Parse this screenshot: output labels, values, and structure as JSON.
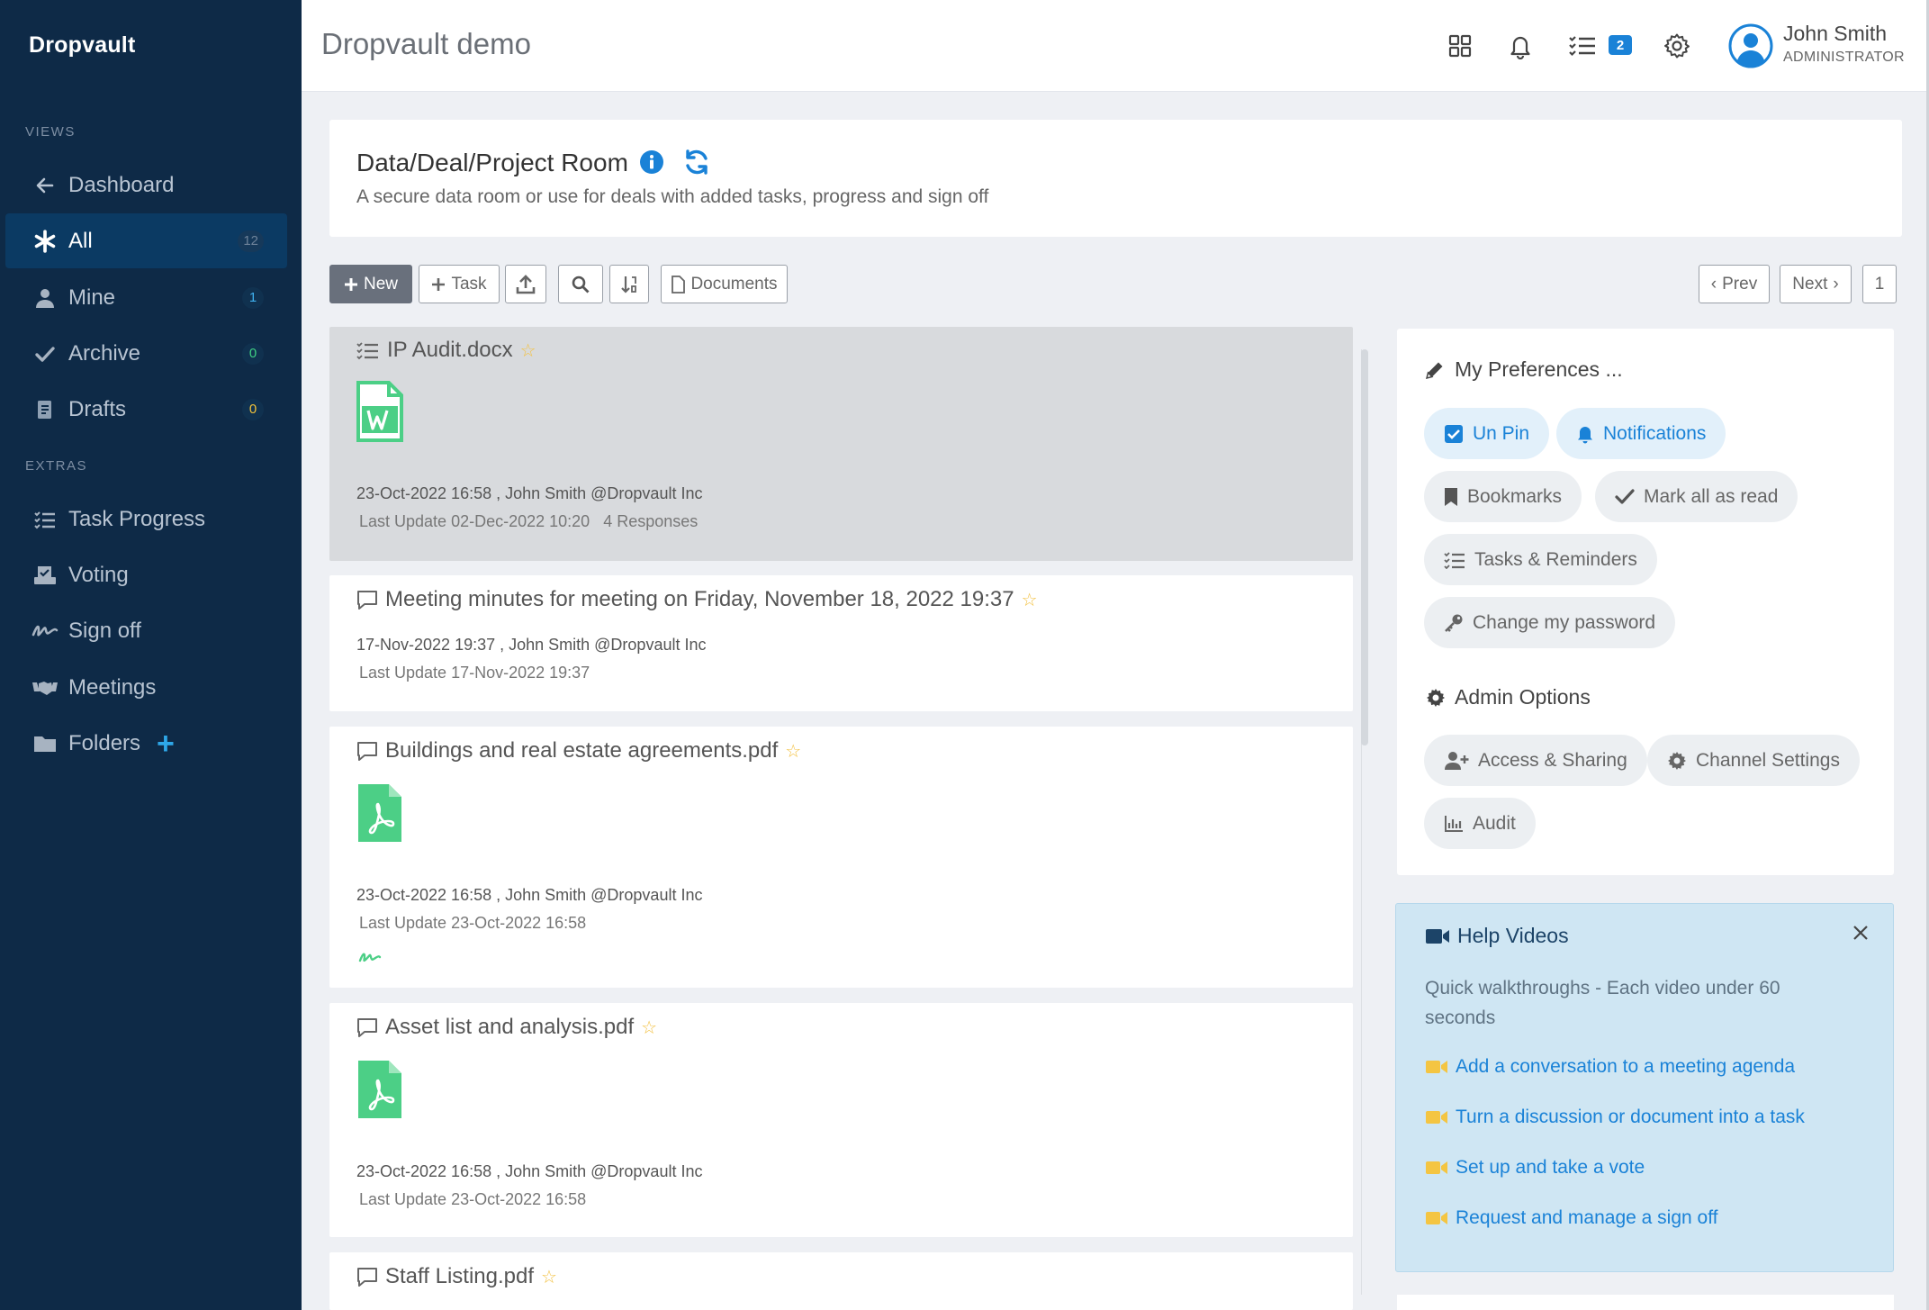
{
  "sidebar": {
    "brand": "Dropvault",
    "views_label": "VIEWS",
    "extras_label": "EXTRAS",
    "views": [
      {
        "label": "Dashboard",
        "icon": "arrow-left-icon",
        "count": null
      },
      {
        "label": "All",
        "icon": "asterisk-icon",
        "count": "12"
      },
      {
        "label": "Mine",
        "icon": "user-icon",
        "count": "1"
      },
      {
        "label": "Archive",
        "icon": "check-icon",
        "count": "0"
      },
      {
        "label": "Drafts",
        "icon": "draft-icon",
        "count": "0"
      }
    ],
    "extras": [
      {
        "label": "Task Progress",
        "icon": "task-list-icon"
      },
      {
        "label": "Voting",
        "icon": "ballot-icon"
      },
      {
        "label": "Sign off",
        "icon": "signature-icon"
      },
      {
        "label": "Meetings",
        "icon": "handshake-icon"
      },
      {
        "label": "Folders",
        "icon": "folder-icon",
        "action": "+"
      }
    ]
  },
  "header": {
    "title": "Dropvault demo",
    "task_badge": "2",
    "user_name": "John Smith",
    "user_role": "ADMINISTRATOR",
    "icons": [
      "grid-icon",
      "bell-icon",
      "task-list-icon",
      "gear-icon",
      "avatar-icon"
    ]
  },
  "room": {
    "title": "Data/Deal/Project Room",
    "subtitle": "A secure data room or use for deals with added tasks, progress and sign off"
  },
  "toolbar": {
    "new_label": "New",
    "task_label": "Task",
    "documents_label": "Documents",
    "prev_label": "Prev",
    "next_label": "Next",
    "page": "1"
  },
  "documents": [
    {
      "title": "IP Audit.docx",
      "type": "word",
      "meta": "23-Oct-2022 16:58 , John Smith @Dropvault Inc",
      "updated": "Last Update 02-Dec-2022 10:20",
      "responses": "4 Responses"
    },
    {
      "title": "Meeting minutes for meeting on Friday, November 18, 2022 19:37",
      "type": "conversation",
      "meta": "17-Nov-2022 19:37 , John Smith @Dropvault Inc",
      "updated": "Last Update 17-Nov-2022 19:37"
    },
    {
      "title": "Buildings and real estate agreements.pdf",
      "type": "pdf",
      "meta": "23-Oct-2022 16:58 , John Smith @Dropvault Inc",
      "updated": "Last Update 23-Oct-2022 16:58"
    },
    {
      "title": "Asset list and analysis.pdf",
      "type": "pdf",
      "meta": "23-Oct-2022 16:58 , John Smith @Dropvault Inc",
      "updated": "Last Update 23-Oct-2022 16:58"
    },
    {
      "title": "Staff Listing.pdf",
      "type": "pdf"
    }
  ],
  "preferences": {
    "title": "My Preferences ...",
    "items": [
      "Un Pin",
      "Notifications",
      "Bookmarks",
      "Mark all as read",
      "Tasks & Reminders",
      "Change my password"
    ],
    "admin_title": "Admin Options",
    "admin_items": [
      "Access & Sharing",
      "Channel Settings",
      "Audit"
    ]
  },
  "help": {
    "title": "Help Videos",
    "description": "Quick walkthroughs - Each video under 60 seconds",
    "links": [
      "Add a conversation to a meeting agenda",
      "Turn a discussion or document into a task",
      "Set up and take a vote",
      "Request and manage a sign off"
    ]
  },
  "colors": {
    "sidebar_bg": "#0e2a47",
    "active_bg": "#0b3a63",
    "accent": "#1a82d7",
    "file_green": "#4ccf86",
    "star": "#f3c244"
  }
}
